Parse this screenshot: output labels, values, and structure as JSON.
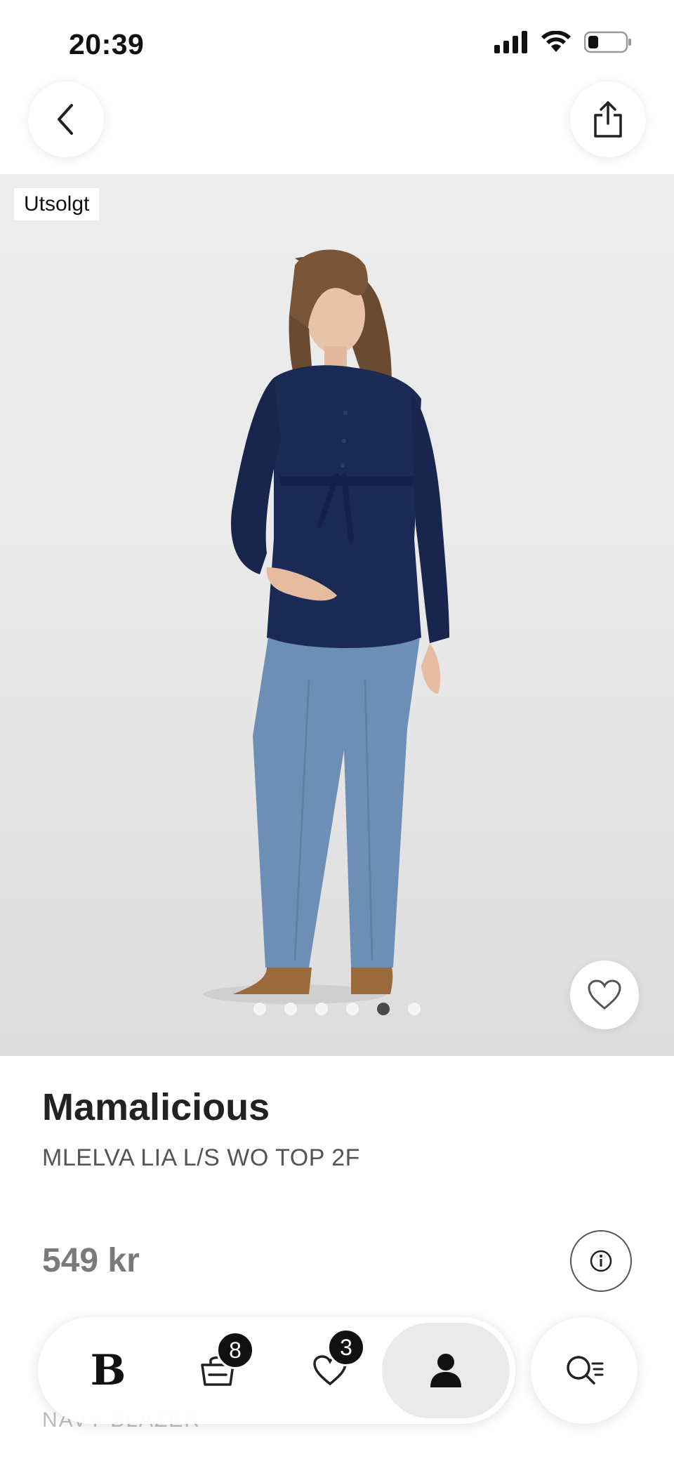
{
  "status_bar": {
    "time": "20:39",
    "icons": [
      "signal-icon",
      "wifi-icon",
      "battery-icon"
    ]
  },
  "header": {
    "back_icon": "chevron-left-icon",
    "share_icon": "share-icon"
  },
  "product_image": {
    "badge": "Utsolgt",
    "dots_total": 6,
    "active_dot_index": 4,
    "favorite_icon": "heart-icon"
  },
  "product": {
    "brand": "Mamalicious",
    "name": "MLELVA LIA L/S WO TOP 2F",
    "price": "549 kr",
    "info_icon": "info-icon"
  },
  "below_content": {
    "partial_text": "NAVY BLAZER"
  },
  "bottom_nav": {
    "home_logo": "B",
    "cart_count": "8",
    "favorites_count": "3",
    "active_item": "profile",
    "search_icon": "search-icon"
  },
  "colors": {
    "shirt": "#1b2a55",
    "jeans": "#6d8fb5",
    "shoes": "#9a6a3c"
  }
}
